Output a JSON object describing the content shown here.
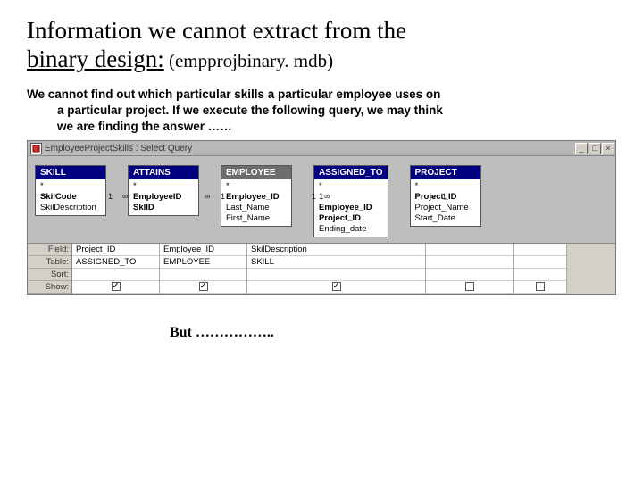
{
  "title_line1": "Information we cannot extract from the",
  "title_line2": "binary design:",
  "title_sub": " (empprojbinary. mdb)",
  "para_line1": "We cannot find out which particular skills a particular employee uses on",
  "para_line2": "a particular project.  If we execute the following query, we may think",
  "para_line3": "we are finding the answer ……",
  "window_title": "EmployeeProjectSkills : Select Query",
  "tables": {
    "skill": {
      "header": "SKILL",
      "rows": [
        "*",
        "SkilCode",
        "SkilDescription"
      ]
    },
    "attains": {
      "header": "ATTAINS",
      "rows": [
        "*",
        "EmployeeID",
        "SklID"
      ]
    },
    "employee": {
      "header": "EMPLOYEE",
      "rows": [
        "*",
        "Employee_ID",
        "Last_Name",
        "First_Name"
      ]
    },
    "assigned": {
      "header": "ASSIGNED_TO",
      "rows": [
        "*",
        "1",
        "Employee_ID",
        "Project_ID",
        "Ending_date"
      ]
    },
    "project": {
      "header": "PROJECT",
      "rows": [
        "*",
        "Project_ID",
        "Project_Name",
        "Start_Date"
      ]
    }
  },
  "relcards": {
    "one": "1",
    "many": "∞"
  },
  "gridlabels": {
    "field": "Field:",
    "table": "Table:",
    "sort": "Sort:",
    "show": "Show:"
  },
  "gridcols": [
    {
      "field": "Project_ID",
      "table": "ASSIGNED_TO",
      "show": true
    },
    {
      "field": "Employee_ID",
      "table": "EMPLOYEE",
      "show": true
    },
    {
      "field": "SkilDescription",
      "table": "SKILL",
      "show": true
    },
    {
      "field": "",
      "table": "",
      "show": false
    },
    {
      "field": "",
      "table": "",
      "show": false
    }
  ],
  "but_text": "But …………….."
}
